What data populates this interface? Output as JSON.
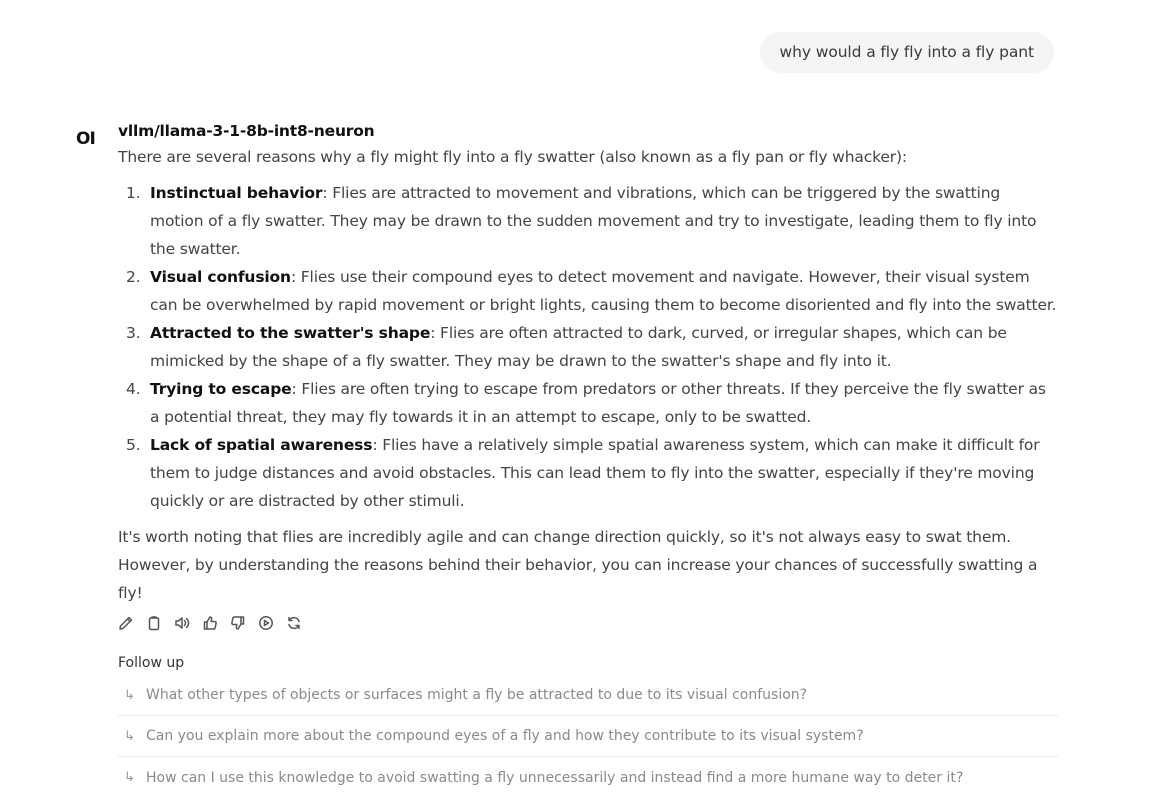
{
  "user_message": "why would a fly fly into a fly pant",
  "assistant": {
    "logo": "OI",
    "model_name": "vllm/llama-3-1-8b-int8-neuron",
    "intro": "There are several reasons why a fly might fly into a fly swatter (also known as a fly pan or fly whacker):",
    "reasons": [
      {
        "num": "1.",
        "title": "Instinctual behavior",
        "text": ": Flies are attracted to movement and vibrations, which can be triggered by the swatting motion of a fly swatter. They may be drawn to the sudden movement and try to investigate, leading them to fly into the swatter."
      },
      {
        "num": "2.",
        "title": "Visual confusion",
        "text": ": Flies use their compound eyes to detect movement and navigate. However, their visual system can be overwhelmed by rapid movement or bright lights, causing them to become disoriented and fly into the swatter."
      },
      {
        "num": "3.",
        "title": "Attracted to the swatter's shape",
        "text": ": Flies are often attracted to dark, curved, or irregular shapes, which can be mimicked by the shape of a fly swatter. They may be drawn to the swatter's shape and fly into it."
      },
      {
        "num": "4.",
        "title": "Trying to escape",
        "text": ": Flies are often trying to escape from predators or other threats. If they perceive the fly swatter as a potential threat, they may fly towards it in an attempt to escape, only to be swatted."
      },
      {
        "num": "5.",
        "title": "Lack of spatial awareness",
        "text": ": Flies have a relatively simple spatial awareness system, which can make it difficult for them to judge distances and avoid obstacles. This can lead them to fly into the swatter, especially if they're moving quickly or are distracted by other stimuli."
      }
    ],
    "closing": "It's worth noting that flies are incredibly agile and can change direction quickly, so it's not always easy to swat them. However, by understanding the reasons behind their behavior, you can increase your chances of successfully swatting a fly!",
    "actions": [
      "edit-icon",
      "copy-icon",
      "read-aloud-icon",
      "thumbs-up-icon",
      "thumbs-down-icon",
      "continue-icon",
      "regenerate-icon"
    ]
  },
  "followup": {
    "title": "Follow up",
    "arrow": "↳",
    "items": [
      "What other types of objects or surfaces might a fly be attracted to due to its visual confusion?",
      "Can you explain more about the compound eyes of a fly and how they contribute to its visual system?",
      "How can I use this knowledge to avoid swatting a fly unnecessarily and instead find a more humane way to deter it?"
    ]
  }
}
